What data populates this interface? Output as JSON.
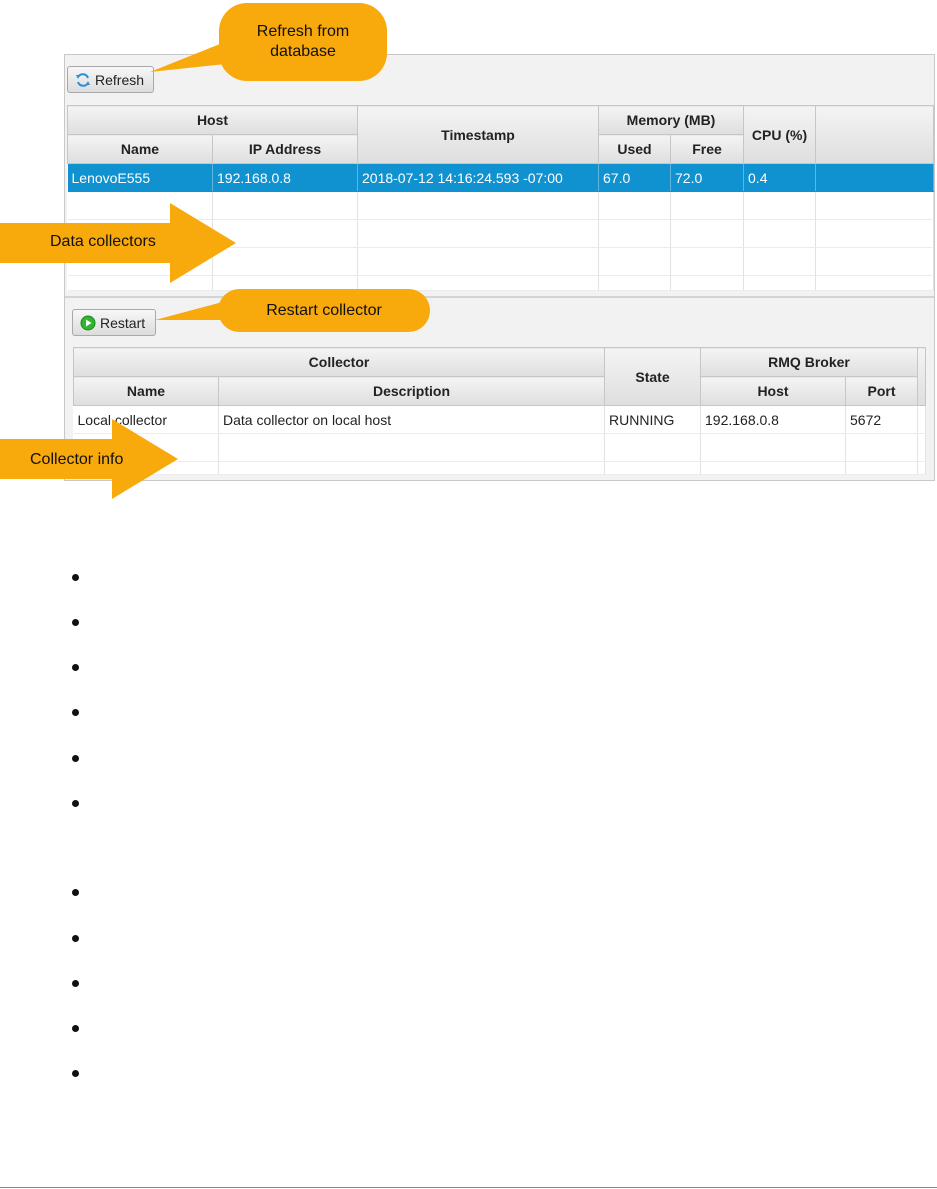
{
  "toolbar": {
    "refresh_label": "Refresh",
    "restart_label": "Restart"
  },
  "hosts_table": {
    "group_headers": {
      "host": "Host",
      "memory": "Memory (MB)"
    },
    "columns": {
      "name": "Name",
      "ip": "IP Address",
      "timestamp": "Timestamp",
      "used": "Used",
      "free": "Free",
      "cpu": "CPU (%)"
    },
    "rows": [
      {
        "name": "LenovoE555",
        "ip": "192.168.0.8",
        "timestamp": "2018-07-12 14:16:24.593 -07:00",
        "used": "67.0",
        "free": "72.0",
        "cpu": "0.4"
      }
    ]
  },
  "collectors_table": {
    "group_headers": {
      "collector": "Collector",
      "broker": "RMQ Broker"
    },
    "columns": {
      "name": "Name",
      "description": "Description",
      "state": "State",
      "host": "Host",
      "port": "Port"
    },
    "rows": [
      {
        "name": "Local collector",
        "description": "Data collector on local host",
        "state": "RUNNING",
        "host": "192.168.0.8",
        "port": "5672"
      }
    ]
  },
  "callouts": {
    "refresh": "Refresh from database",
    "data_collectors": "Data collectors",
    "restart": "Restart collector",
    "collector_info": "Collector info"
  },
  "colors": {
    "selection": "#0f92cf",
    "callout": "#f8a90b",
    "restart_icon": "#2fb52f",
    "refresh_icon": "#2a8fd6"
  },
  "icons": {
    "refresh": "refresh-icon",
    "restart": "play-icon"
  },
  "bullet_count": 11
}
